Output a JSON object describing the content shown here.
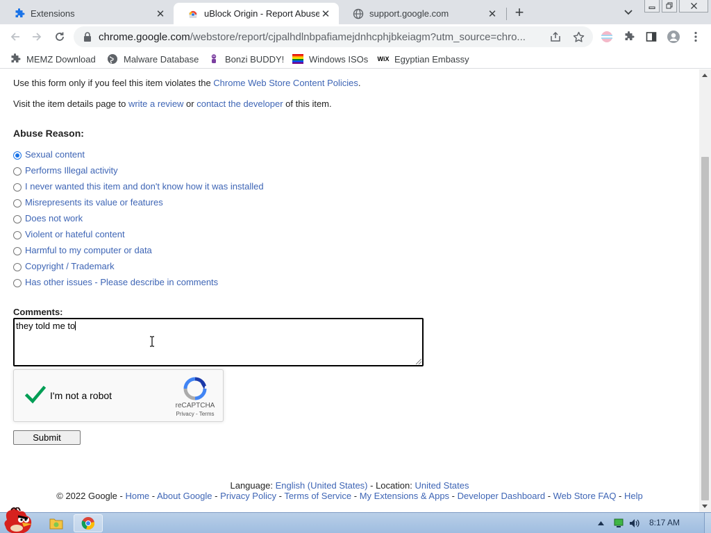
{
  "tabs": [
    {
      "title": "Extensions",
      "icon": "puzzle-icon",
      "active": false
    },
    {
      "title": "uBlock Origin - Report Abuse",
      "icon": "webstore-icon",
      "active": true
    },
    {
      "title": "support.google.com",
      "icon": "globe-icon",
      "active": false
    }
  ],
  "address_bar": {
    "host": "chrome.google.com",
    "path": "/webstore/report/cjpalhdlnbpafiamejdnhcphjbkeiagm?utm_source=chro..."
  },
  "bookmarks": [
    {
      "label": "MEMZ Download",
      "icon": "puzzle-icon"
    },
    {
      "label": "Malware Database",
      "icon": "globe-icon"
    },
    {
      "label": "Bonzi BUDDY!",
      "icon": "bonzi-icon"
    },
    {
      "label": "Windows ISOs",
      "icon": "flag-icon"
    },
    {
      "label": "Egyptian Embassy",
      "icon": "wix-icon"
    }
  ],
  "intro": {
    "line1_pre": "Use this form only if you feel this item violates the ",
    "line1_link": "Chrome Web Store Content Policies",
    "line1_post": ".",
    "line2_pre": "Visit the item details page to ",
    "line2_link1": "write a review",
    "line2_mid": " or ",
    "line2_link2": "contact the developer",
    "line2_post": " of this item."
  },
  "abuse_reason": {
    "heading": "Abuse Reason:",
    "options": [
      {
        "label": "Sexual content",
        "checked": true
      },
      {
        "label": "Performs Illegal activity",
        "checked": false
      },
      {
        "label": "I never wanted this item and don't know how it was installed",
        "checked": false
      },
      {
        "label": "Misrepresents its value or features",
        "checked": false
      },
      {
        "label": "Does not work",
        "checked": false
      },
      {
        "label": "Violent or hateful content",
        "checked": false
      },
      {
        "label": "Harmful to my computer or data",
        "checked": false
      },
      {
        "label": "Copyright / Trademark",
        "checked": false
      },
      {
        "label": "Has other issues - Please describe in comments",
        "checked": false
      }
    ]
  },
  "comments": {
    "label": "Comments:",
    "value": "they told me to"
  },
  "recaptcha": {
    "label": "I'm not a robot",
    "brand": "reCAPTCHA",
    "terms": "Privacy - Terms"
  },
  "submit_label": "Submit",
  "footer": {
    "language_label": "Language: ",
    "language_value": "English (United States)",
    "location_sep": " - Location: ",
    "location_value": "United States",
    "copyright": "© 2022 Google",
    "sep": " - ",
    "links": [
      "Home",
      "About Google",
      "Privacy Policy",
      "Terms of Service",
      "My Extensions & Apps",
      "Developer Dashboard",
      "Web Store FAQ",
      "Help"
    ]
  },
  "taskbar": {
    "clock": "8:17 AM"
  }
}
